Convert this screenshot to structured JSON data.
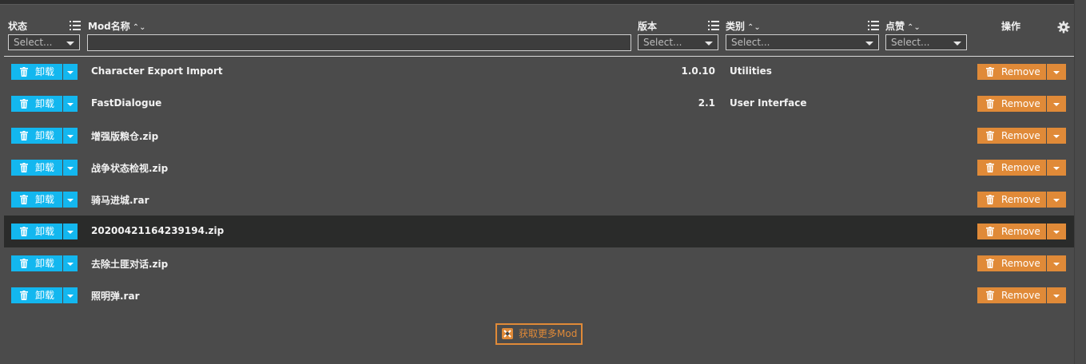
{
  "header": {
    "status": "状态",
    "modname": "Mod名称",
    "version": "版本",
    "category": "类别",
    "likes": "点赞",
    "actions": "操作"
  },
  "filters": {
    "status_placeholder": "Select...",
    "modname_value": "",
    "version_placeholder": "Select...",
    "category_placeholder": "Select...",
    "likes_placeholder": "Select..."
  },
  "row_buttons": {
    "uninstall": "卸载",
    "remove": "Remove"
  },
  "mods": [
    {
      "name": "Character Export Import",
      "version": "1.0.10",
      "category": "Utilities"
    },
    {
      "name": "FastDialogue",
      "version": "2.1",
      "category": "User Interface"
    },
    {
      "name": "增强版粮仓.zip",
      "version": "",
      "category": ""
    },
    {
      "name": "战争状态检视.zip",
      "version": "",
      "category": ""
    },
    {
      "name": "骑马进城.rar",
      "version": "",
      "category": ""
    },
    {
      "name": "20200421164239194.zip",
      "version": "",
      "category": ""
    },
    {
      "name": "去除土匪对话.zip",
      "version": "",
      "category": ""
    },
    {
      "name": "照明弹.rar",
      "version": "",
      "category": ""
    }
  ],
  "footer": {
    "get_more": "获取更多Mod"
  },
  "colors": {
    "uninstall": "#13b7ef",
    "remove": "#e08a38",
    "highlight_row": "#2a2b2a",
    "background": "#4b4b4b"
  }
}
